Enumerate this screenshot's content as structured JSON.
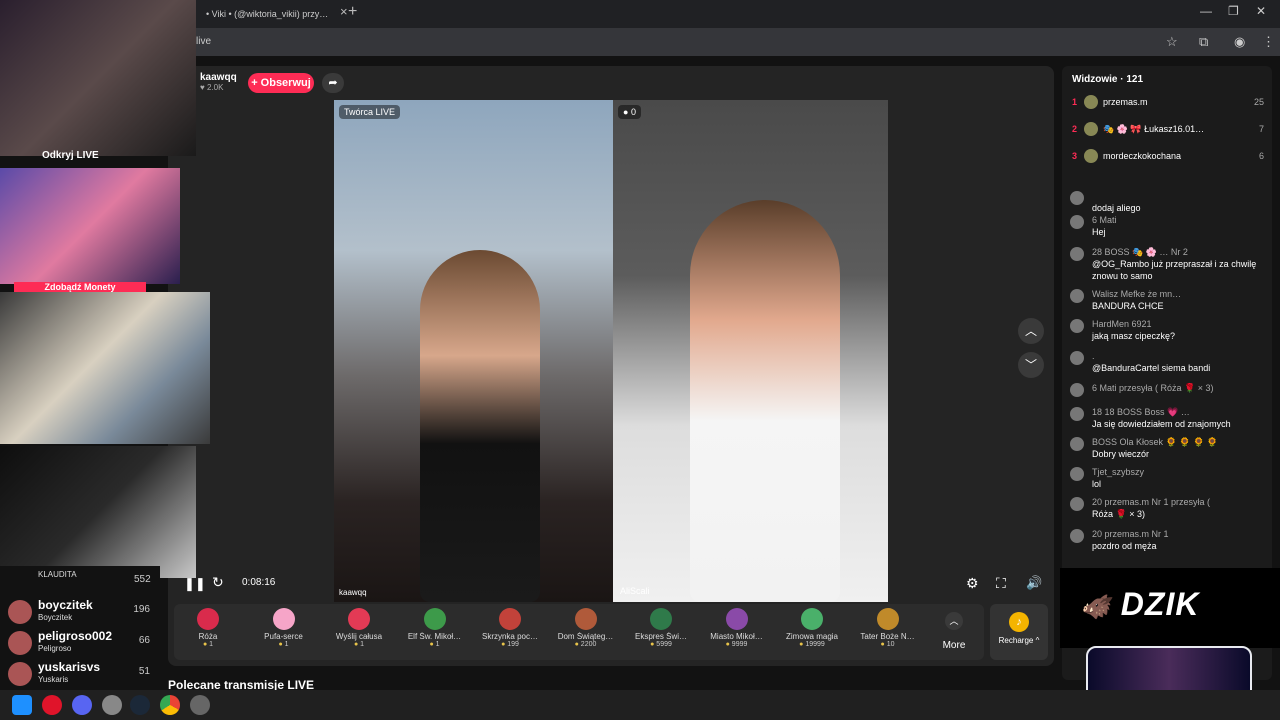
{
  "browser": {
    "tab_title": "• Viki • (@wiktoria_vikii) przy…",
    "url": "live"
  },
  "host": {
    "name": "kaawqq",
    "likes": "♥ 2.0K",
    "follow_label": "+ Obserwuj"
  },
  "stage": {
    "left_badge": "Twórca LIVE",
    "right_count": "0",
    "left_name": "kaawqq",
    "right_name": "AliScali",
    "time": "0:08:16"
  },
  "gifts": [
    {
      "name": "Róża",
      "price": "1",
      "color": "#d92b4c"
    },
    {
      "name": "Pufa-serce",
      "price": "1",
      "color": "#f6a5c8"
    },
    {
      "name": "Wyślij całusa",
      "price": "1",
      "color": "#e33a55"
    },
    {
      "name": "Elf Św. Mikoł…",
      "price": "1",
      "color": "#3d9a4a"
    },
    {
      "name": "Skrzynka poc…",
      "price": "199",
      "color": "#c2423a"
    },
    {
      "name": "Dom Świąteg…",
      "price": "2200",
      "color": "#b05a3a"
    },
    {
      "name": "Ekspres Świ…",
      "price": "5999",
      "color": "#2f7a4a"
    },
    {
      "name": "Miasto Mikoł…",
      "price": "9999",
      "color": "#8a4aa8"
    },
    {
      "name": "Zimowa magia",
      "price": "19999",
      "color": "#4ab06a"
    },
    {
      "name": "Tater Boże N…",
      "price": "10",
      "color": "#c08a2a"
    }
  ],
  "more_label": "More",
  "recharge_label": "Recharge ^",
  "recommended": "Polecane transmisje LIVE",
  "viewers": {
    "label": "Widzowie · 121",
    "top": [
      {
        "rank": "1",
        "name": "przemas.m",
        "score": "25"
      },
      {
        "rank": "2",
        "name": "🎭 🌸 🎀 Łukasz16.01…",
        "score": "7"
      },
      {
        "rank": "3",
        "name": "mordeczkokochana",
        "score": "6"
      }
    ]
  },
  "chat": [
    {
      "user": "",
      "text": "dodaj aliego"
    },
    {
      "user": "6  Mati",
      "text": "Hej"
    },
    {
      "user": "28  BOSS  🎭 🌸 …  Nr 2",
      "text": "@OG_Rambo już przepraszał i za chwilę znowu to samo"
    },
    {
      "user": "Walisz Mefke że mn…",
      "text": "BANDURA CHCE"
    },
    {
      "user": "HardMen 6921",
      "text": "jaką masz cipeczkę?"
    },
    {
      "user": ".",
      "text": "@BanduraCartel siema bandi"
    },
    {
      "user": "6  Mati  przesyła ( Róża 🌹 × 3)",
      "text": ""
    },
    {
      "user": "18  18  BOSS  Boss 💗 …",
      "text": "Ja się dowiedziałem od znajomych"
    },
    {
      "user": "BOSS  Ola Kłosek 🌻 🌻 🌻 🌻",
      "text": "Dobry wieczór"
    },
    {
      "user": "Tjet_szybszy",
      "text": "lol"
    },
    {
      "user": "20  przemas.m  Nr 1  przesyła (",
      "text": "Róża 🌹 × 3)"
    },
    {
      "user": "20  przemas.m  Nr 1",
      "text": "pozdro od męża"
    }
  ],
  "brand": "DZIK",
  "left_list": [
    {
      "name": "boyczitek",
      "sub": "Boyczitek",
      "count": "196"
    },
    {
      "name": "peligroso002",
      "sub": "Peligroso",
      "count": "66"
    },
    {
      "name": "yuskarisvs",
      "sub": "Yuskaris",
      "count": "51"
    }
  ],
  "left_partial": {
    "label": "Odkryj LIVE",
    "coins": "Zdobądź Monety",
    "top_count": "552",
    "top_sub": "KLAUDITA"
  }
}
